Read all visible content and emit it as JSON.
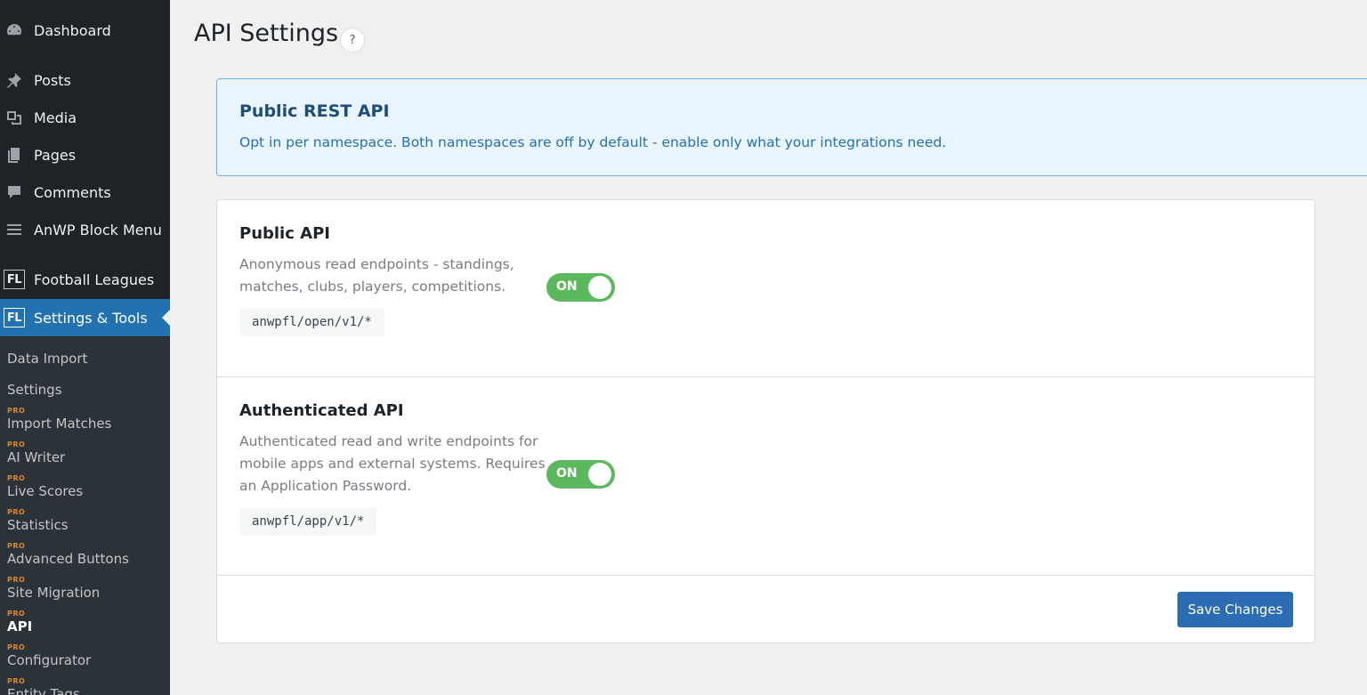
{
  "sidebar": {
    "items": [
      {
        "label": "Dashboard",
        "icon": "dashboard-icon"
      },
      {
        "label": "Posts",
        "icon": "pin-icon"
      },
      {
        "label": "Media",
        "icon": "media-icon"
      },
      {
        "label": "Pages",
        "icon": "pages-icon"
      },
      {
        "label": "Comments",
        "icon": "comment-icon"
      },
      {
        "label": "AnWP Block Menu",
        "icon": "menu-icon"
      },
      {
        "label": "Football Leagues",
        "icon": "fl-icon",
        "badge": "FL"
      },
      {
        "label": "Settings & Tools",
        "icon": "fl-icon",
        "badge": "FL"
      }
    ],
    "submenu": [
      {
        "label": "Data Import",
        "pro": ""
      },
      {
        "label": "Settings",
        "pro": ""
      },
      {
        "label": "Import Matches",
        "pro": "PRO"
      },
      {
        "label": "AI Writer",
        "pro": "PRO"
      },
      {
        "label": "Live Scores",
        "pro": "PRO"
      },
      {
        "label": "Statistics",
        "pro": "PRO"
      },
      {
        "label": "Advanced Buttons",
        "pro": "PRO"
      },
      {
        "label": "Site Migration",
        "pro": "PRO"
      },
      {
        "label": "API",
        "pro": "PRO"
      },
      {
        "label": "Configurator",
        "pro": "PRO"
      },
      {
        "label": "Entity Tags",
        "pro": "PRO"
      }
    ]
  },
  "page": {
    "title": "API Settings",
    "help": "?"
  },
  "notice": {
    "title": "Public REST API",
    "description": "Opt in per namespace. Both namespaces are off by default - enable only what your integrations need."
  },
  "sections": [
    {
      "title": "Public API",
      "description": "Anonymous read endpoints - standings, matches, clubs, players, competitions.",
      "namespace": "anwpfl/open/v1/*",
      "toggle": "ON"
    },
    {
      "title": "Authenticated API",
      "description": "Authenticated read and write endpoints for mobile apps and external systems. Requires an Application Password.",
      "namespace": "anwpfl/app/v1/*",
      "toggle": "ON"
    }
  ],
  "save_button": "Save Changes",
  "colors": {
    "sidebar_bg": "#1d2327",
    "submenu_bg": "#2c3338",
    "accent": "#2271b1",
    "toggle_on": "#5cb85c",
    "pro_badge": "#d98a2f"
  }
}
